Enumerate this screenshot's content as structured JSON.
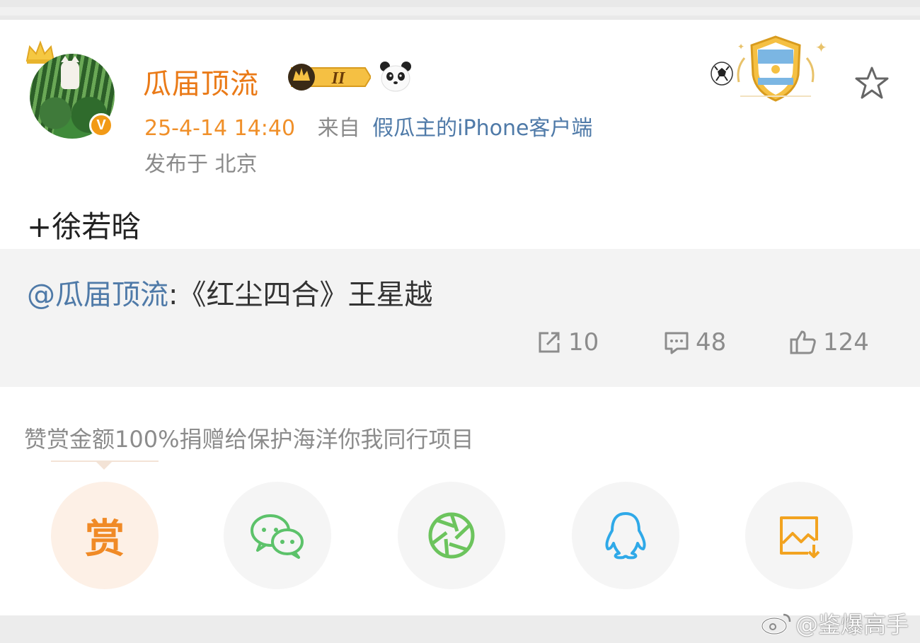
{
  "post": {
    "author": "瓜届顶流",
    "vip_level": "II",
    "time": "25-4-14 14:40",
    "from_label": "来自",
    "client": "假瓜主的iPhone客户端",
    "location": "发布于 北京",
    "text": "+徐若晗"
  },
  "repost": {
    "user": "@瓜届顶流",
    "separator": ":",
    "text": "《红尘四合》王星越"
  },
  "stats": {
    "shares": "10",
    "comments": "48",
    "likes": "124"
  },
  "reward": {
    "text": "赞赏金额100%捐赠给保护海洋你我同行项目",
    "button_label": "赏"
  },
  "share_targets": [
    "reward",
    "wechat",
    "moments",
    "qq",
    "save-image"
  ],
  "icons": {
    "avatar_verified": "v-badge",
    "favorite": "star-icon",
    "share": "share-icon",
    "comment": "comment-icon",
    "like": "thumbs-up-icon"
  },
  "watermark": "@鉴爆高手",
  "colors": {
    "username": "#ea7a17",
    "time": "#f0902a",
    "link": "#4f7aa8",
    "secondary": "#8a8a8a",
    "repost_bg": "#f3f3f3"
  }
}
